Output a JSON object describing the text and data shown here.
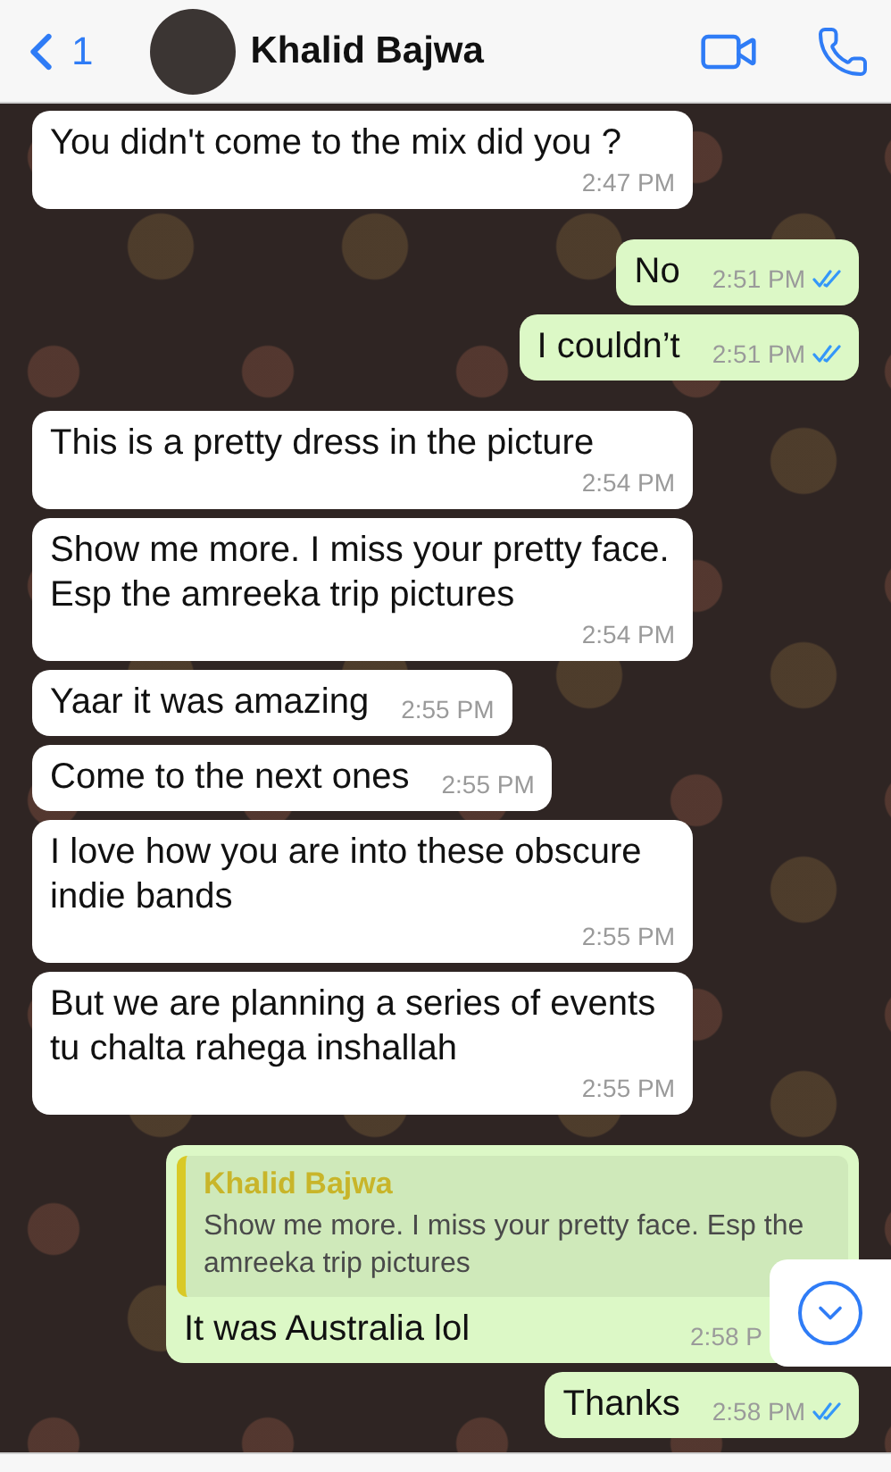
{
  "header": {
    "back_count": "1",
    "contact_name": "Khalid Bajwa"
  },
  "messages": [
    {
      "kind": "incoming",
      "text": "You didn't come to the mix did you ?",
      "time": "2:47 PM"
    },
    {
      "kind": "outgoing",
      "text": "No",
      "time": "2:51 PM",
      "read": true
    },
    {
      "kind": "outgoing",
      "text": "I couldn’t",
      "time": "2:51 PM",
      "read": true
    },
    {
      "kind": "incoming",
      "text": "This is a pretty dress in the picture",
      "time": "2:54 PM"
    },
    {
      "kind": "incoming",
      "text": "Show me more. I miss your pretty face. Esp the amreeka trip pictures",
      "time": "2:54 PM"
    },
    {
      "kind": "incoming",
      "text": "Yaar it was amazing",
      "time": "2:55 PM"
    },
    {
      "kind": "incoming",
      "text": "Come to the next ones",
      "time": "2:55 PM"
    },
    {
      "kind": "incoming",
      "text": "I love how you are into these obscure indie bands",
      "time": "2:55 PM"
    },
    {
      "kind": "incoming",
      "text": "But we are planning a series of events tu chalta rahega inshallah",
      "time": "2:55 PM"
    },
    {
      "kind": "outgoing",
      "reply_to": {
        "author": "Khalid Bajwa",
        "text": "Show me more. I miss your pretty face. Esp the amreeka trip pictures"
      },
      "text": "It was Australia lol",
      "time": "2:58 P"
    },
    {
      "kind": "outgoing",
      "text": "Thanks",
      "time": "2:58 PM",
      "read": true
    }
  ]
}
